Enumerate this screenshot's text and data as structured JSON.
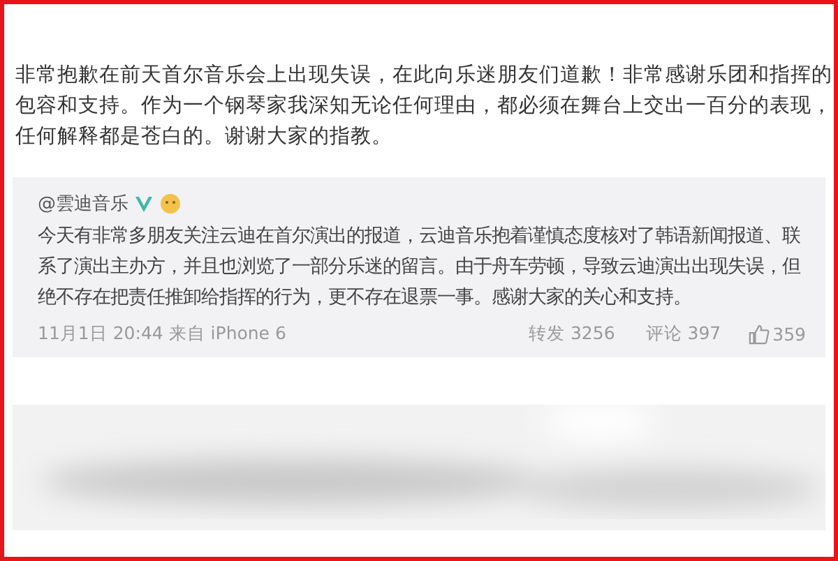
{
  "post": {
    "text": "非常抱歉在前天首尔音乐会上出现失误，在此向乐迷朋友们道歉！非常感谢乐团和指挥的包容和支持。作为一个钢琴家我深知无论任何理由，都必须在舞台上交出一百分的表现，任何解释都是苍白的。谢谢大家的指教。"
  },
  "repost": {
    "author": "@雲迪音乐",
    "verified": true,
    "text": "今天有非常多朋友关注云迪在首尔演出的报道，云迪音乐抱着谨慎态度核对了韩语新闻报道、联系了演出主办方，并且也浏览了一部分乐迷的留言。由于舟车劳顿，导致云迪演出出现失误，但绝不存在把责任推卸给指挥的行为，更不存在退票一事。感谢大家的关心和支持。",
    "meta": "11月1日 20:44 来自 iPhone 6",
    "reposts": "转发 3256",
    "comments": "评论 397",
    "likes": "359"
  }
}
